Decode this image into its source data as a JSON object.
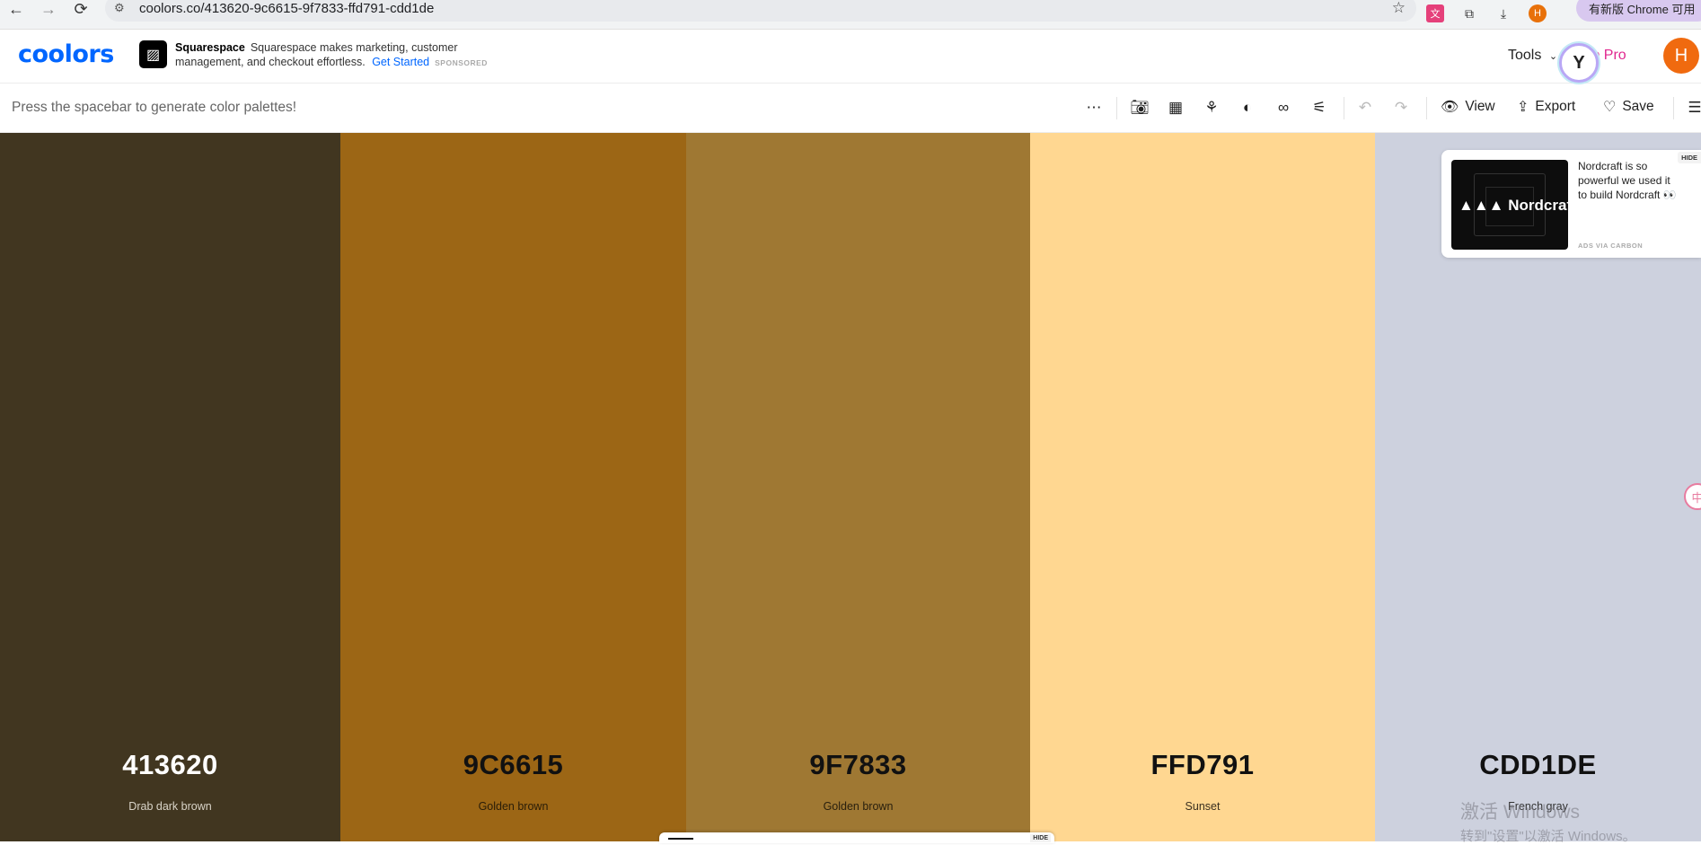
{
  "browser": {
    "url": "coolors.co/413620-9c6615-9f7833-ffd791-cdd1de",
    "profile_initial": "H",
    "update_label": "有新版 Chrome 可用"
  },
  "header": {
    "logo_text": "coolors",
    "ad": {
      "brand": "Squarespace",
      "text": "Squarespace makes marketing, customer management, and checkout effortless.",
      "cta": "Get Started",
      "sponsored": "SPONSORED"
    },
    "tools_label": "Tools",
    "go_pro_label": "Go Pro",
    "user_initial": "H"
  },
  "toolbar": {
    "hint": "Press the spacebar to generate color palettes!",
    "view_label": "View",
    "export_label": "Export",
    "save_label": "Save"
  },
  "palette": [
    {
      "hex": "413620",
      "name": "Drab dark brown",
      "color": "#413620",
      "text_color": "#ffffff",
      "name_color": "#d9d4c8"
    },
    {
      "hex": "9C6615",
      "name": "Golden brown",
      "color": "#9C6615",
      "text_color": "#111111",
      "name_color": "#2a1d08"
    },
    {
      "hex": "9F7833",
      "name": "Golden brown",
      "color": "#9F7833",
      "text_color": "#111111",
      "name_color": "#2a200e"
    },
    {
      "hex": "FFD791",
      "name": "Sunset",
      "color": "#FFD791",
      "text_color": "#111111",
      "name_color": "#3a3020"
    },
    {
      "hex": "CDD1DE",
      "name": "French gray",
      "color": "#CDD1DE",
      "text_color": "#111111",
      "name_color": "#333333"
    }
  ],
  "carbon_ad": {
    "brand": "Nordcraft",
    "text": "Nordcraft is so powerful we used it to build Nordcraft 👀",
    "via": "ADS VIA CARBON",
    "hide": "HIDE"
  },
  "watermark": {
    "line1": "激活 Windows",
    "line2": "转到\"设置\"以激活 Windows。"
  },
  "bottom_tab": {
    "hide": "HIDE"
  }
}
